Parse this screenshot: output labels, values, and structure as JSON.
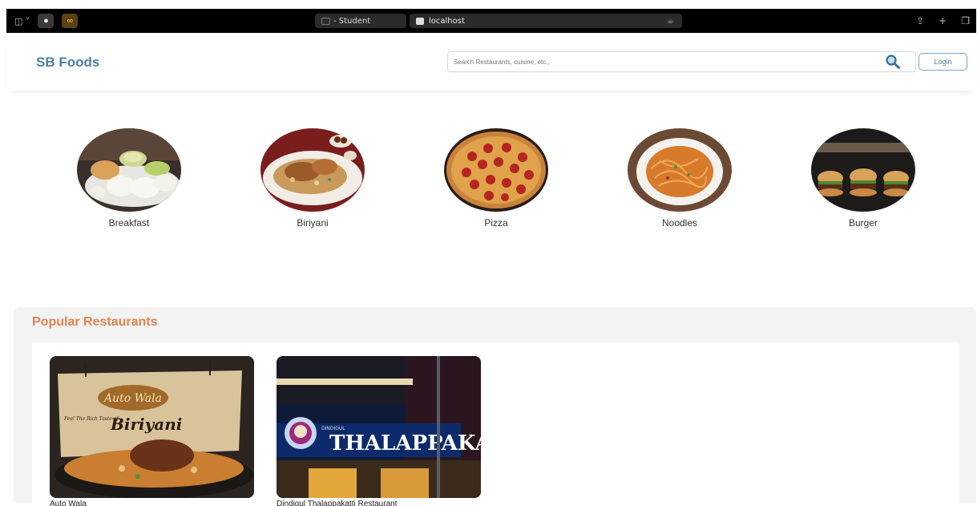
{
  "browser": {
    "tab_title": "- Student",
    "url": "localhost",
    "extension_label": "∞"
  },
  "header": {
    "logo": "SB Foods",
    "search_placeholder": "Search Restaurants, cuisine, etc.,",
    "login_label": "Login"
  },
  "categories": [
    {
      "label": "Breakfast",
      "icon": "idli-photo"
    },
    {
      "label": "Biriyani",
      "icon": "biryani-photo"
    },
    {
      "label": "Pizza",
      "icon": "pizza-photo"
    },
    {
      "label": "Noodles",
      "icon": "noodles-photo"
    },
    {
      "label": "Burger",
      "icon": "burger-photo"
    }
  ],
  "popular": {
    "title": "Popular Restaurants",
    "restaurants": [
      {
        "name": "Auto Wala",
        "sign_brand": "Auto Wala",
        "sign_text": "Biriyani",
        "sign_tagline": "Feel The Rich Taste of"
      },
      {
        "name": "Dindigul Thalappakatti Restaurant",
        "sign_text": "THALAPPAKATTI",
        "sign_brand": "DINDIGUL"
      }
    ]
  },
  "colors": {
    "brand": "#4b80a8",
    "accent": "#df8650"
  }
}
